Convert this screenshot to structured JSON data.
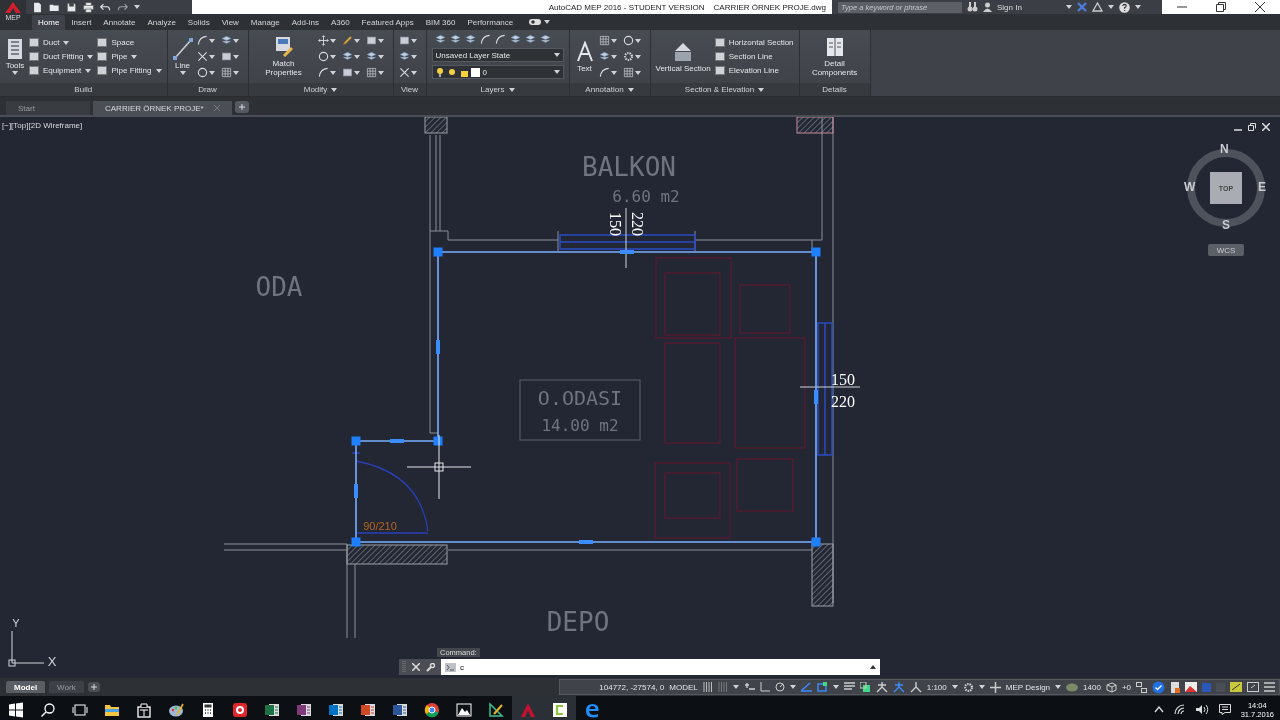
{
  "app_menu": {
    "label": "MEP"
  },
  "window": {
    "title": "AutoCAD MEP 2016 - STUDENT VERSION",
    "file": "CARRIER ÖRNEK PROJE.dwg"
  },
  "search": {
    "placeholder": "Type a keyword or phrase"
  },
  "account": {
    "label": "Sign In"
  },
  "ribbon_tabs": [
    {
      "label": "Home",
      "selected": true
    },
    {
      "label": "Insert",
      "selected": false
    },
    {
      "label": "Annotate",
      "selected": false
    },
    {
      "label": "Analyze",
      "selected": false
    },
    {
      "label": "Solids",
      "selected": false
    },
    {
      "label": "View",
      "selected": false
    },
    {
      "label": "Manage",
      "selected": false
    },
    {
      "label": "Add-ins",
      "selected": false
    },
    {
      "label": "A360",
      "selected": false
    },
    {
      "label": "Featured Apps",
      "selected": false
    },
    {
      "label": "BIM 360",
      "selected": false
    },
    {
      "label": "Performance",
      "selected": false
    }
  ],
  "ribbon_panels": [
    {
      "title": "Build",
      "menu": false,
      "tools": [
        {
          "kind": "large",
          "label": "Tools",
          "dropdown": true
        },
        {
          "kind": "small",
          "label": "Duct",
          "dropdown": true
        },
        {
          "kind": "small",
          "label": "Duct Fitting",
          "dropdown": true
        },
        {
          "kind": "small",
          "label": "Equipment",
          "dropdown": true
        },
        {
          "kind": "small",
          "label": "Space",
          "dropdown": false
        },
        {
          "kind": "small",
          "label": "Pipe",
          "dropdown": true
        },
        {
          "kind": "small",
          "label": "Pipe Fitting",
          "dropdown": true
        }
      ]
    },
    {
      "title": "Draw",
      "menu": false,
      "tools": [
        {
          "kind": "large",
          "label": "Line",
          "dropdown": true
        },
        {
          "kind": "icons"
        }
      ]
    },
    {
      "title": "Modify",
      "menu": true,
      "tools": [
        {
          "kind": "large",
          "label": "Match Properties",
          "dropdown": false
        },
        {
          "kind": "icons"
        }
      ]
    },
    {
      "title": "View",
      "menu": false,
      "tools": [
        {
          "kind": "icons"
        }
      ]
    },
    {
      "title": "Layers",
      "menu": true,
      "tools": [
        {
          "kind": "combo",
          "value": "Unsaved Layer State"
        },
        {
          "kind": "combo",
          "value": "0"
        }
      ]
    },
    {
      "title": "Annotation",
      "menu": true,
      "tools": [
        {
          "kind": "large",
          "label": "Text",
          "dropdown": false
        },
        {
          "kind": "icons"
        }
      ]
    },
    {
      "title": "Section & Elevation",
      "menu": true,
      "tools": [
        {
          "kind": "large",
          "label": "Vertical Section",
          "dropdown": false
        },
        {
          "kind": "small",
          "label": "Horizontal Section",
          "dropdown": false
        },
        {
          "kind": "small",
          "label": "Section Line",
          "dropdown": false
        },
        {
          "kind": "small",
          "label": "Elevation Line",
          "dropdown": false
        }
      ]
    },
    {
      "title": "Details",
      "menu": false,
      "tools": [
        {
          "kind": "large",
          "label": "Detail Components",
          "dropdown": false
        }
      ]
    }
  ],
  "file_tabs": [
    {
      "label": "Start",
      "selected": false,
      "closable": false
    },
    {
      "label": "CARRIER ÖRNEK PROJE*",
      "selected": true,
      "closable": true
    }
  ],
  "viewport": {
    "controls": "[−][Top][2D Wireframe]"
  },
  "viewcube": {
    "north": "N",
    "south": "S",
    "east": "E",
    "west": "W",
    "face": "TOP",
    "ucs": "WCS"
  },
  "drawing": {
    "labels": [
      {
        "kind": "room",
        "text": "BALKON"
      },
      {
        "kind": "area",
        "text": "6.60 m2"
      },
      {
        "kind": "room",
        "text": "ODA"
      },
      {
        "kind": "room",
        "text": "O.ODASI"
      },
      {
        "kind": "area",
        "text": "14.00 m2"
      },
      {
        "kind": "room",
        "text": "DEPO"
      },
      {
        "kind": "dimension",
        "text": "150"
      },
      {
        "kind": "dimension",
        "text": "220"
      },
      {
        "kind": "dimension",
        "text": "150"
      },
      {
        "kind": "dimension",
        "text": "220"
      },
      {
        "kind": "door-tag",
        "text": "90/210"
      }
    ],
    "ucs_axes": {
      "x": "X",
      "y": "Y"
    }
  },
  "command": {
    "label": "Command:",
    "value": "c"
  },
  "layout_tabs": [
    {
      "label": "Model",
      "selected": true
    },
    {
      "label": "Work",
      "selected": false
    }
  ],
  "status_bar": {
    "coordinates": "104772, -27574, 0",
    "space": "MODEL",
    "scale": "1:100",
    "workspace": "MEP Design",
    "elevation": "1400",
    "offset": "+0"
  },
  "taskbar": {
    "time": "14:04",
    "date": "31.7.2016"
  }
}
